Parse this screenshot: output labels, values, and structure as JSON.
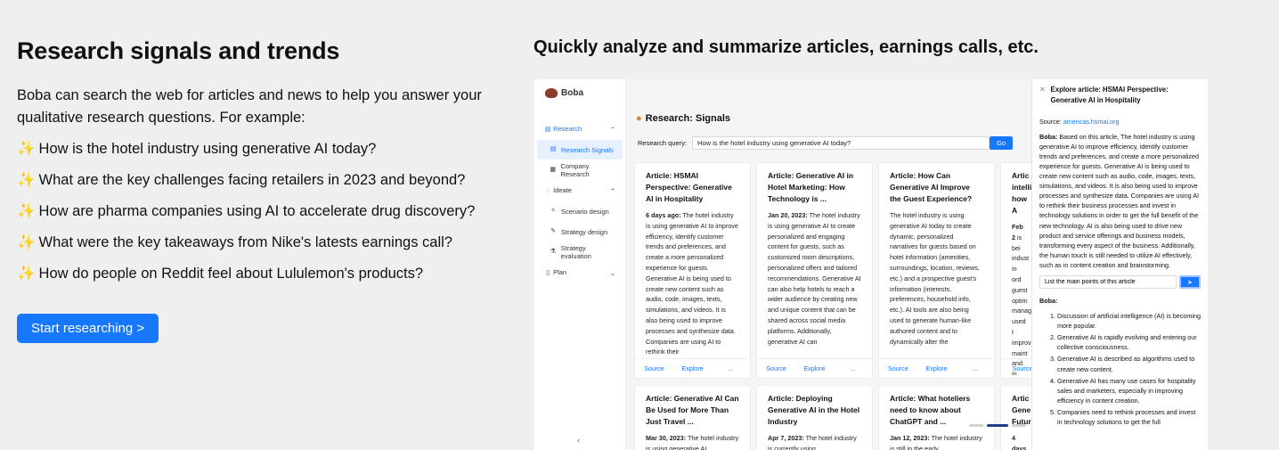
{
  "left": {
    "heading": "Research signals and trends",
    "intro": "Boba can search the web for articles and news to help you answer your qualitative research questions. For example:",
    "spark": "✨",
    "questions": [
      "How is the hotel industry using generative AI today?",
      "What are the key challenges facing retailers in 2023 and beyond?",
      "How are pharma companies using AI to accelerate drug discovery?",
      "What were the key takeaways from Nike's latests earnings call?",
      "How do people on Reddit feel about Lululemon's products?"
    ],
    "cta": "Start researching >"
  },
  "right_title": "Quickly analyze and summarize articles, earnings calls, etc.",
  "app": {
    "brand": "Boba",
    "nav": {
      "research": "Research",
      "research_signals": "Research Signals",
      "company_research": "Company Research",
      "ideate": "Ideate",
      "scenario_design": "Scenario design",
      "strategy_design": "Strategy design",
      "strategy_evaluation": "Strategy evaluation",
      "plan": "Plan"
    },
    "page_title": "Research: Signals",
    "query_label": "Research query:",
    "query_value": "How is the hotel industry using generative AI today?",
    "go": "Go",
    "footer": {
      "source": "Source",
      "explore": "Explore",
      "more": "..."
    },
    "cards": [
      {
        "title": "Article: HSMAI Perspective: Generative AI in Hospitality",
        "date": "6 days ago:",
        "text": " The hotel industry is using generative AI to improve efficiency, identify customer trends and preferences, and create a more personalized experience for guests. Generative AI is being used to create new content such as audio, code, images, texts, simulations, and videos. It is also being used to improve processes and synthesize data. Companies are using AI to rethink their"
      },
      {
        "title": "Article: Generative AI in Hotel Marketing: How Technology is ...",
        "date": "Jan 20, 2023:",
        "text": " The hotel industry is using generative AI to create personalized and engaging content for guests, such as customized room descriptions, personalized offers and tailored recommendations. Generative AI can also help hotels to reach a wider audience by creating new and unique content that can be shared across social media platforms. Additionally, generative AI can"
      },
      {
        "title": "Article: How Can Generative AI Improve the Guest Experience?",
        "date": "",
        "text": "The hotel industry is using generative AI today to create dynamic, personalized narratives for guests based on hotel information (amenities, surroundings, location, reviews, etc.) and a prospective guest's information (interests, preferences, household info, etc.). AI tools are also being used to generate human-like authored content and to dynamically alter the"
      },
      {
        "title": "Artic intelli how A",
        "date": "Feb 2",
        "text": " is bei indust in ord guest optim manag used t improv maint and in invent use of seaso"
      },
      {
        "title": "Article: Generative AI Can Be Used for More Than Just Travel ...",
        "date": "Mar 30, 2023:",
        "text": " The hotel industry is using generative AI"
      },
      {
        "title": "Article: Deploying Generative AI in the Hotel Industry",
        "date": "Apr 7, 2023:",
        "text": " The hotel industry is currently using"
      },
      {
        "title": "Article: What hoteliers need to know about ChatGPT and ...",
        "date": "Jan 12, 2023:",
        "text": " The hotel industry is still in the early"
      },
      {
        "title": "Artic Gene Futur",
        "date": "4 days",
        "text": " indust"
      }
    ],
    "panel": {
      "title": "Explore article: HSMAI Perspective: Generative AI in Hospitality",
      "source_label": "Source: ",
      "source_link": "americas.hsmai.org",
      "answer_label": "Boba:",
      "answer_text": " Based on this article, The hotel industry is using generative AI to improve efficiency, identify customer trends and preferences, and create a more personalized experience for guests. Generative AI is being used to create new content such as audio, code, images, texts, simulations, and videos. It is also being used to improve processes and synthesize data. Companies are using AI to rethink their business processes and invest in technology solutions in order to get the full benefit of the new technology. AI is also being used to drive new product and service offerings and business models, transforming every aspect of the business. Additionally, the human touch is still needed to utilize AI effectively, such as in content creation and brainstorming.",
      "ask_value": "List the main points of this article",
      "send": "➤",
      "second_label": "Boba:",
      "points": [
        "Discussion of artificial intelligence (AI) is becoming more popular.",
        "Generative AI is rapidly evolving and entering our collective consciousness.",
        "Generative AI is described as algorithms used to create new content.",
        "Generative AI has many use cases for hospitality sales and marketers, especially in improving efficiency in content creation.",
        "Companies need to rethink processes and invest in technology solutions to get the full"
      ]
    }
  }
}
